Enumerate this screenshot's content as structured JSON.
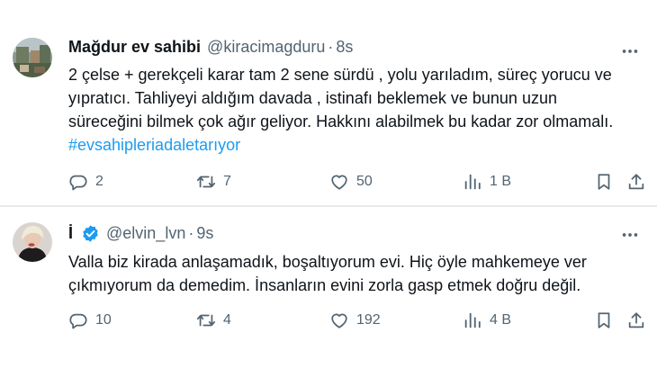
{
  "tweets": [
    {
      "display_name": "Mağdur ev sahibi",
      "handle": "@kiracimagduru",
      "time": "8s",
      "verified": false,
      "text_lines": [
        "2 çelse + gerekçeli karar tam 2 sene sürdü , yolu yarıladım, süreç yorucu ve",
        "yıpratıcı. Tahliyeyi aldığım davada , istinafı beklemek ve bunun uzun",
        "süreceğini bilmek çok ağır geliyor. Hakkını alabilmek bu kadar zor olmamalı."
      ],
      "hashtag": "#evsahipleriadaletarıyor",
      "actions": {
        "replies": "2",
        "retweets": "7",
        "likes": "50",
        "views": "1 B"
      }
    },
    {
      "display_name": "İ",
      "handle": "@elvin_lvn",
      "time": "9s",
      "verified": true,
      "text_lines": [
        "Valla biz kirada anlaşamadık, boşaltıyorum evi. Hiç öyle mahkemeye ver",
        "çıkmıyorum da demedim. İnsanların  evini zorla gasp etmek doğru değil."
      ],
      "actions": {
        "replies": "10",
        "retweets": "4",
        "likes": "192",
        "views": "4 B"
      }
    }
  ],
  "icons": {
    "reply": "reply-icon",
    "retweet": "retweet-icon",
    "like": "heart-icon",
    "views": "views-icon",
    "bookmark": "bookmark-icon",
    "share": "share-icon",
    "more": "more-icon",
    "verified": "verified-badge-icon"
  },
  "colors": {
    "text": "#0f1419",
    "muted": "#536471",
    "accent": "#1d9bf0",
    "divider": "#e7e9ea"
  }
}
